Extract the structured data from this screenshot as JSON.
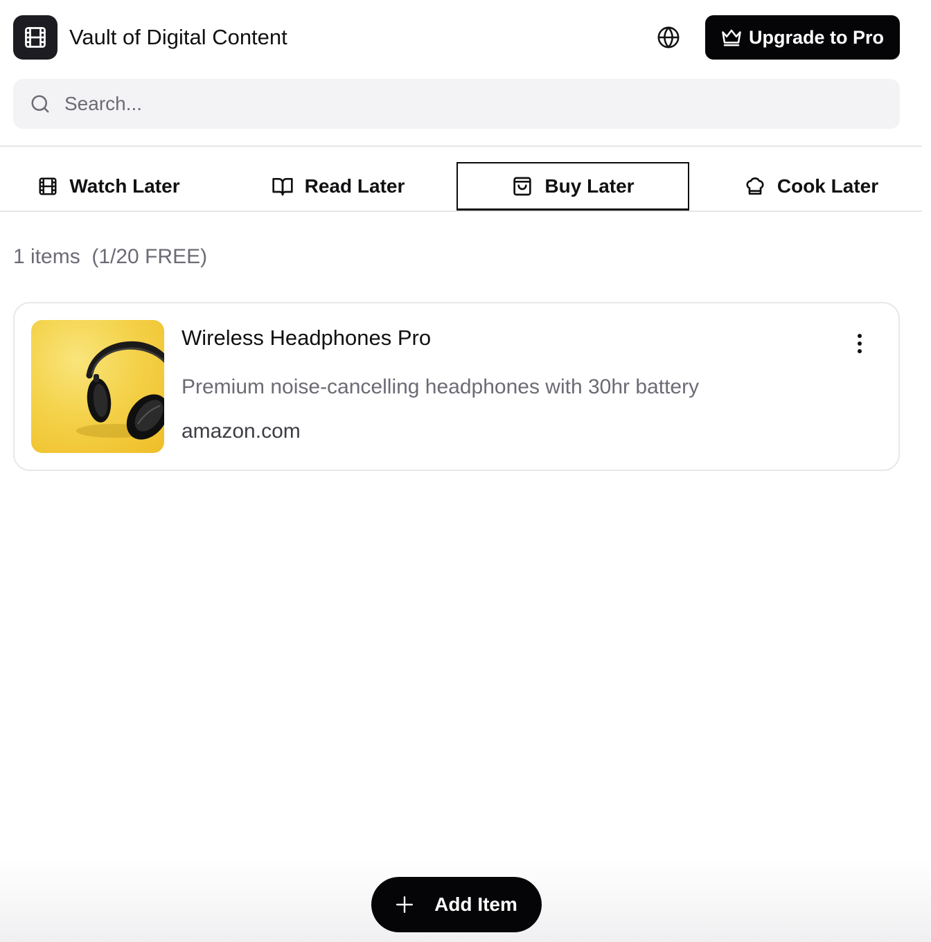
{
  "header": {
    "app_icon": "film-icon",
    "title": "Vault of Digital Content",
    "language_icon": "globe-icon",
    "upgrade_label": "Upgrade to Pro",
    "upgrade_icon": "crown-icon"
  },
  "search": {
    "placeholder": "Search...",
    "value": "",
    "icon": "search-icon"
  },
  "tabs": [
    {
      "label": "Watch Later",
      "icon": "film-icon",
      "active": false
    },
    {
      "label": "Read Later",
      "icon": "book-open-icon",
      "active": false
    },
    {
      "label": "Buy Later",
      "icon": "shopping-bag-icon",
      "active": true
    },
    {
      "label": "Cook Later",
      "icon": "chef-hat-icon",
      "active": false
    }
  ],
  "summary": {
    "count_text": "1 items  (1/20 FREE)"
  },
  "items": [
    {
      "title": "Wireless Headphones Pro",
      "description": "Premium noise-cancelling headphones with 30hr battery",
      "source": "amazon.com",
      "thumbnail": "headphones-thumbnail",
      "menu_icon": "more-vertical-icon"
    }
  ],
  "actions": {
    "add_label": "Add Item",
    "add_icon": "plus-icon"
  },
  "colors": {
    "primary": "#050507",
    "muted_text": "#6b6b75",
    "search_bg": "#f3f3f5",
    "border": "#e8e8ec",
    "thumb_yellow": "#f4d24a"
  }
}
